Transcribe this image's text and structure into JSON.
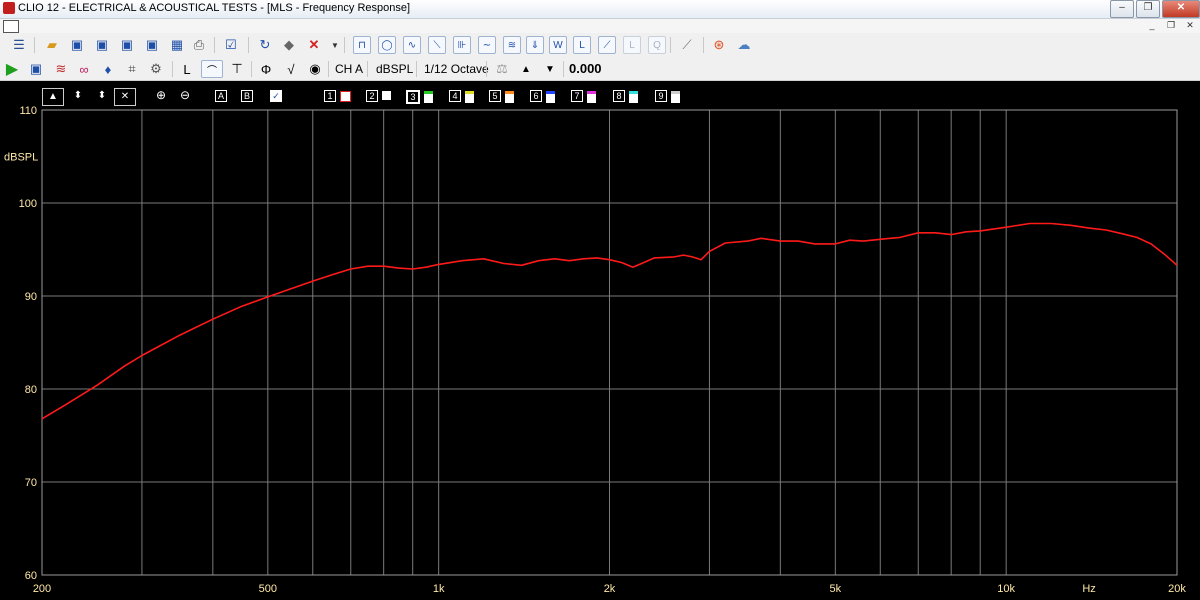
{
  "window": {
    "title": "CLIO 12 - ELECTRICAL & ACOUSTICAL TESTS - [MLS - Frequency Response]",
    "minimize": "‒",
    "restore": "❐",
    "close": "✕",
    "mdi_minimize": "_",
    "mdi_restore": "❐",
    "mdi_close": "✕"
  },
  "toolbar2": {
    "channel_label": "CH A",
    "unit_label": "dBSPL",
    "smoothing_label": "1/12 Octave",
    "value_display": "0.000"
  },
  "chart_controls": {
    "up_arrow": "▲",
    "updown_arrow": "⬍",
    "x_label": "✕",
    "zoom_in": "⊕",
    "zoom_out": "⊖",
    "marker_a": "A",
    "marker_b": "B",
    "traces": [
      "1",
      "2",
      "3",
      "4",
      "5",
      "6",
      "7",
      "8",
      "9"
    ]
  },
  "chart_data": {
    "type": "line",
    "xlabel": "Hz",
    "ylabel": "dBSPL",
    "x_scale": "log",
    "xlim": [
      200,
      20000
    ],
    "ylim": [
      60,
      110
    ],
    "grid": true,
    "x_ticks": [
      {
        "v": 200,
        "label": "200"
      },
      {
        "v": 500,
        "label": "500"
      },
      {
        "v": 1000,
        "label": "1k"
      },
      {
        "v": 2000,
        "label": "2k"
      },
      {
        "v": 5000,
        "label": "5k"
      },
      {
        "v": 10000,
        "label": "10k"
      },
      {
        "v": 20000,
        "label": "20k"
      }
    ],
    "y_ticks": [
      {
        "v": 110,
        "label": "110"
      },
      {
        "v": 100,
        "label": "100"
      },
      {
        "v": 90,
        "label": "90"
      },
      {
        "v": 80,
        "label": "80"
      },
      {
        "v": 70,
        "label": "70"
      },
      {
        "v": 60,
        "label": "60"
      }
    ],
    "colors": {
      "background": "#000000",
      "grid": "#7a7a7a",
      "axis_text": "#ffe9a8",
      "trace": "#ff1a1a"
    },
    "series": [
      {
        "x": [
          200,
          220,
          250,
          280,
          300,
          350,
          400,
          450,
          500,
          550,
          600,
          650,
          700,
          750,
          800,
          850,
          900,
          950,
          1000,
          1100,
          1200,
          1300,
          1400,
          1500,
          1600,
          1700,
          1800,
          1900,
          2000,
          2100,
          2200,
          2400,
          2600,
          2700,
          2800,
          2900,
          3000,
          3200,
          3500,
          3700,
          4000,
          4300,
          4600,
          5000,
          5300,
          5600,
          6000,
          6500,
          7000,
          7500,
          8000,
          8500,
          9000,
          10000,
          11000,
          12000,
          13000,
          14000,
          15000,
          16000,
          17000,
          18000,
          19000,
          20000
        ],
        "y": [
          76.8,
          78.3,
          80.4,
          82.5,
          83.6,
          85.8,
          87.5,
          88.9,
          89.9,
          90.8,
          91.6,
          92.3,
          92.9,
          93.2,
          93.2,
          93.0,
          92.9,
          93.1,
          93.4,
          93.8,
          94.0,
          93.5,
          93.3,
          93.8,
          94.0,
          93.8,
          94.0,
          94.1,
          93.9,
          93.6,
          93.1,
          94.1,
          94.2,
          94.4,
          94.2,
          93.9,
          94.8,
          95.7,
          95.9,
          96.2,
          95.9,
          95.9,
          95.6,
          95.6,
          96.0,
          95.9,
          96.1,
          96.3,
          96.8,
          96.8,
          96.6,
          96.9,
          97.0,
          97.4,
          97.8,
          97.8,
          97.6,
          97.3,
          97.1,
          96.7,
          96.3,
          95.6,
          94.5,
          93.3
        ]
      }
    ]
  }
}
